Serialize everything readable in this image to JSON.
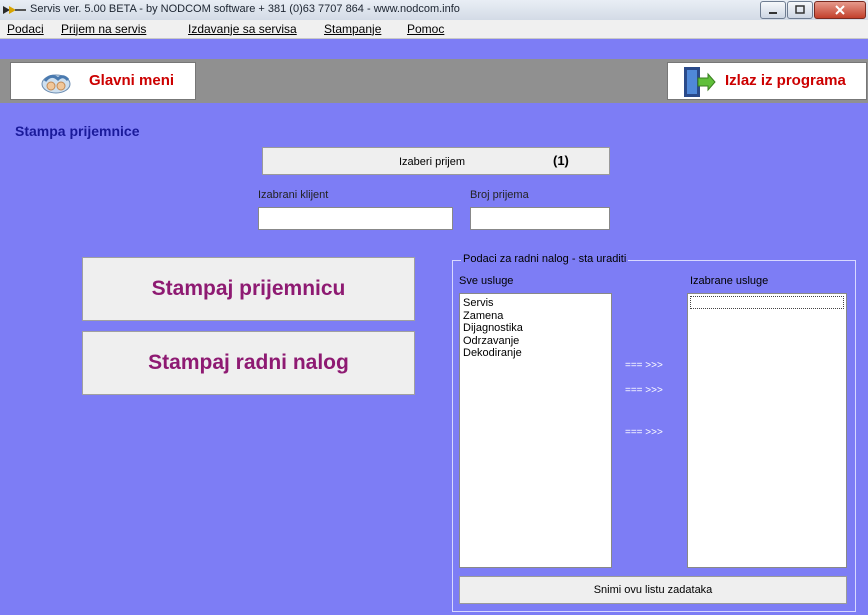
{
  "window": {
    "title": "Servis ver. 5.00 BETA - by NODCOM software  + 381 (0)63 7707 864 - www.nodcom.info",
    "controls": [
      "minimize-icon",
      "maximize-icon",
      "close-icon"
    ]
  },
  "menu": {
    "items": [
      {
        "label": "Podaci",
        "accel": "P"
      },
      {
        "label": "Prijem na servis",
        "accel": "r"
      },
      {
        "label": "Izdavanje sa servisa",
        "accel": "I"
      },
      {
        "label": "Stampanje",
        "accel": "S"
      },
      {
        "label": "Pomoc",
        "accel": "o"
      }
    ]
  },
  "toolbar": {
    "main_menu_label": "Glavni meni",
    "exit_label": "Izlaz iz programa"
  },
  "page": {
    "heading": "Stampa prijemnice"
  },
  "receipt": {
    "select_button_label": "Izaberi prijem",
    "select_button_count": "(1)",
    "client_label": "Izabrani klijent",
    "client_value": "",
    "number_label": "Broj prijema",
    "number_value": ""
  },
  "actions": {
    "print_receipt_label": "Stampaj prijemnicu",
    "print_work_order_label": "Stampaj radni nalog"
  },
  "work_order": {
    "group_title": "Podaci za radni nalog - sta uraditi",
    "all_services_label": "Sve usluge",
    "selected_services_label": "Izabrane usluge",
    "all_services": [
      "Servis",
      "Zamena",
      "Dijagnostika",
      "Odrzavanje",
      "Dekodiranje"
    ],
    "selected_services": [],
    "arrow_labels": [
      "=== >>>",
      "=== >>>",
      "=== >>>"
    ],
    "save_button_label": "Snimi ovu listu zadataka"
  },
  "colors": {
    "background": "#7d7df5",
    "heading": "#1a1a9a",
    "big_button_text": "#8e1a72",
    "toolbar_accent": "#cc0000"
  }
}
